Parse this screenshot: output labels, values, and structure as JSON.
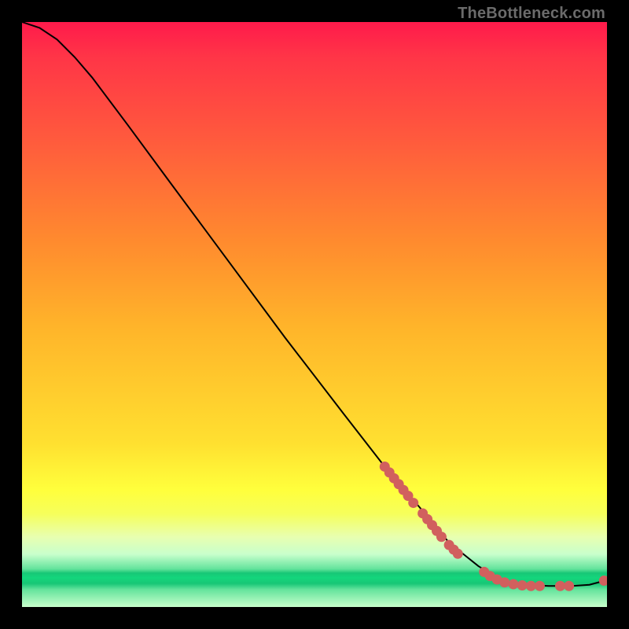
{
  "watermark": "TheBottleneck.com",
  "chart_data": {
    "type": "line",
    "title": "",
    "xlabel": "",
    "ylabel": "",
    "xlim": [
      0,
      100
    ],
    "ylim": [
      0,
      100
    ],
    "grid": false,
    "legend": false,
    "curve": [
      {
        "x": 0,
        "y": 100
      },
      {
        "x": 3,
        "y": 99
      },
      {
        "x": 6,
        "y": 97
      },
      {
        "x": 9,
        "y": 94
      },
      {
        "x": 12,
        "y": 90.5
      },
      {
        "x": 18,
        "y": 82.5
      },
      {
        "x": 25,
        "y": 73
      },
      {
        "x": 35,
        "y": 59.5
      },
      {
        "x": 45,
        "y": 46
      },
      {
        "x": 55,
        "y": 33
      },
      {
        "x": 62,
        "y": 24
      },
      {
        "x": 68,
        "y": 17
      },
      {
        "x": 73,
        "y": 11
      },
      {
        "x": 78,
        "y": 7
      },
      {
        "x": 82,
        "y": 4.5
      },
      {
        "x": 86,
        "y": 3.8
      },
      {
        "x": 90,
        "y": 3.6
      },
      {
        "x": 94,
        "y": 3.6
      },
      {
        "x": 97,
        "y": 3.8
      },
      {
        "x": 100,
        "y": 4.6
      }
    ],
    "dots": [
      {
        "x": 62.0,
        "y": 24.0
      },
      {
        "x": 62.8,
        "y": 23.0
      },
      {
        "x": 63.6,
        "y": 22.0
      },
      {
        "x": 64.4,
        "y": 21.0
      },
      {
        "x": 65.2,
        "y": 20.0
      },
      {
        "x": 66.0,
        "y": 19.0
      },
      {
        "x": 66.9,
        "y": 17.8
      },
      {
        "x": 68.5,
        "y": 16.0
      },
      {
        "x": 69.3,
        "y": 15.0
      },
      {
        "x": 70.1,
        "y": 14.0
      },
      {
        "x": 70.9,
        "y": 13.0
      },
      {
        "x": 71.7,
        "y": 12.0
      },
      {
        "x": 73.0,
        "y": 10.6
      },
      {
        "x": 73.8,
        "y": 9.8
      },
      {
        "x": 74.5,
        "y": 9.1
      },
      {
        "x": 79.0,
        "y": 6.0
      },
      {
        "x": 80.0,
        "y": 5.3
      },
      {
        "x": 81.2,
        "y": 4.7
      },
      {
        "x": 82.5,
        "y": 4.2
      },
      {
        "x": 84.0,
        "y": 3.9
      },
      {
        "x": 85.5,
        "y": 3.7
      },
      {
        "x": 87.0,
        "y": 3.6
      },
      {
        "x": 88.5,
        "y": 3.6
      },
      {
        "x": 92.0,
        "y": 3.6
      },
      {
        "x": 93.5,
        "y": 3.6
      },
      {
        "x": 99.5,
        "y": 4.5
      }
    ],
    "dot_color": "#d1605e",
    "curve_color": "#000000"
  }
}
